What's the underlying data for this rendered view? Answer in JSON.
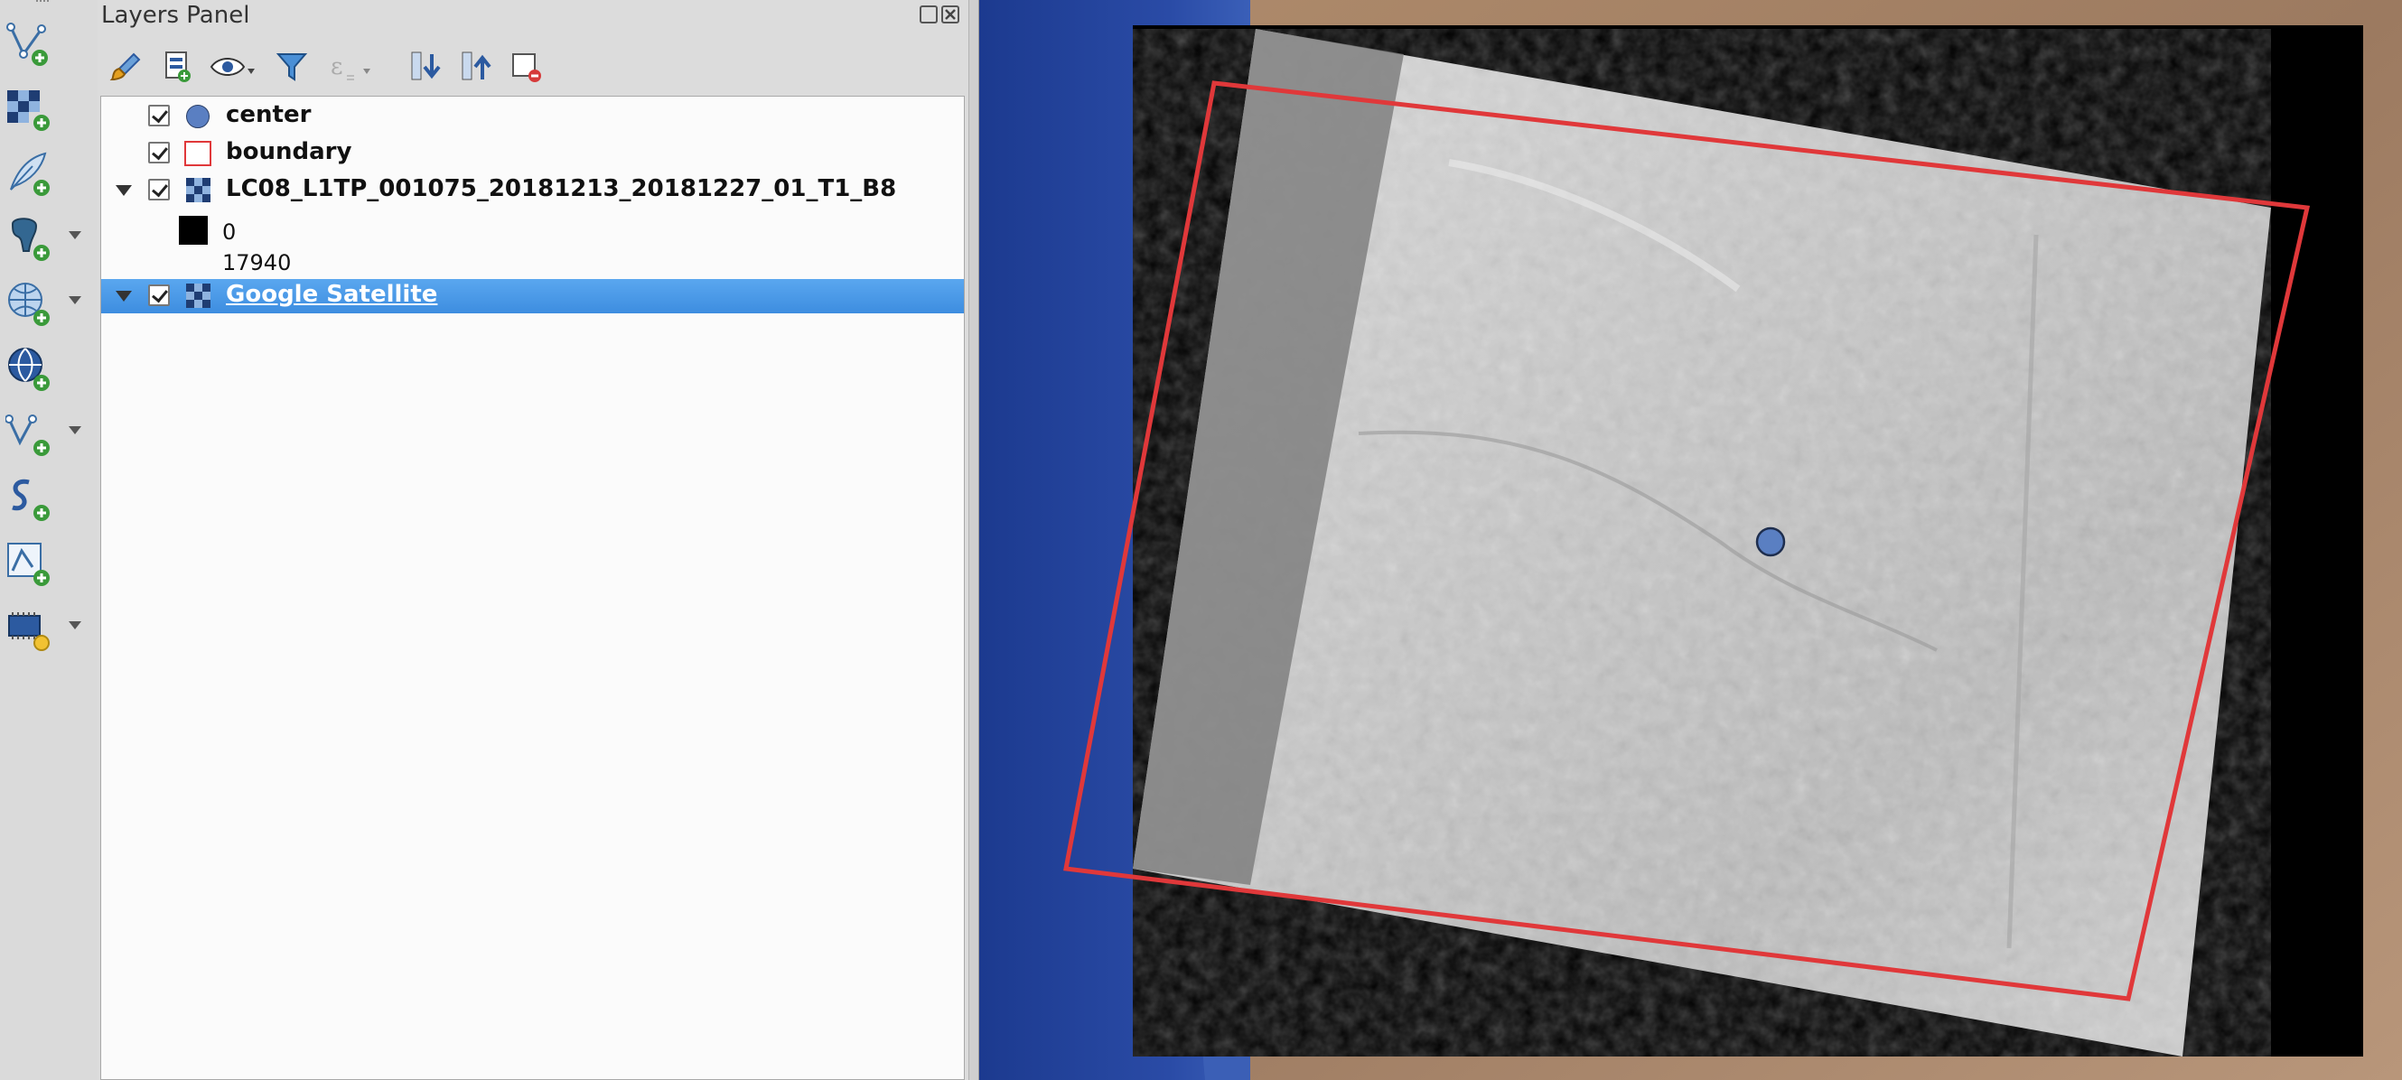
{
  "panel": {
    "title": "Layers Panel"
  },
  "layers": [
    {
      "name": "center",
      "type": "point",
      "checked": true,
      "expanded": false
    },
    {
      "name": "boundary",
      "type": "polygon",
      "checked": true,
      "expanded": false
    },
    {
      "name": "LC08_L1TP_001075_20181213_20181227_01_T1_B8",
      "type": "raster",
      "checked": true,
      "expanded": true,
      "legend": {
        "min_label": "0",
        "max_label": "17940"
      }
    },
    {
      "name": "Google Satellite",
      "type": "raster",
      "checked": true,
      "expanded": false,
      "selected": true
    }
  ],
  "colors": {
    "selection": "#3d8de0",
    "boundary_stroke": "#e0383a",
    "point_fill": "#5a7fc2",
    "ocean": "#23409a",
    "desert": "#a88468"
  },
  "toolbar_icons": [
    "new-vector-layer-icon",
    "new-raster-layer-icon",
    "digitize-feather-icon",
    "postgis-layer-icon",
    "wms-layer-icon",
    "wfs-globe-layer-icon",
    "virtual-layer-icon",
    "spatialite-layer-icon",
    "vector-tile-icon",
    "processing-chip-icon"
  ],
  "panel_toolbar_icons": [
    "style-brush-icon",
    "add-group-icon",
    "visibility-eye-icon",
    "filter-funnel-icon",
    "expression-filter-icon",
    "expand-all-icon",
    "collapse-all-icon",
    "remove-layer-icon"
  ]
}
